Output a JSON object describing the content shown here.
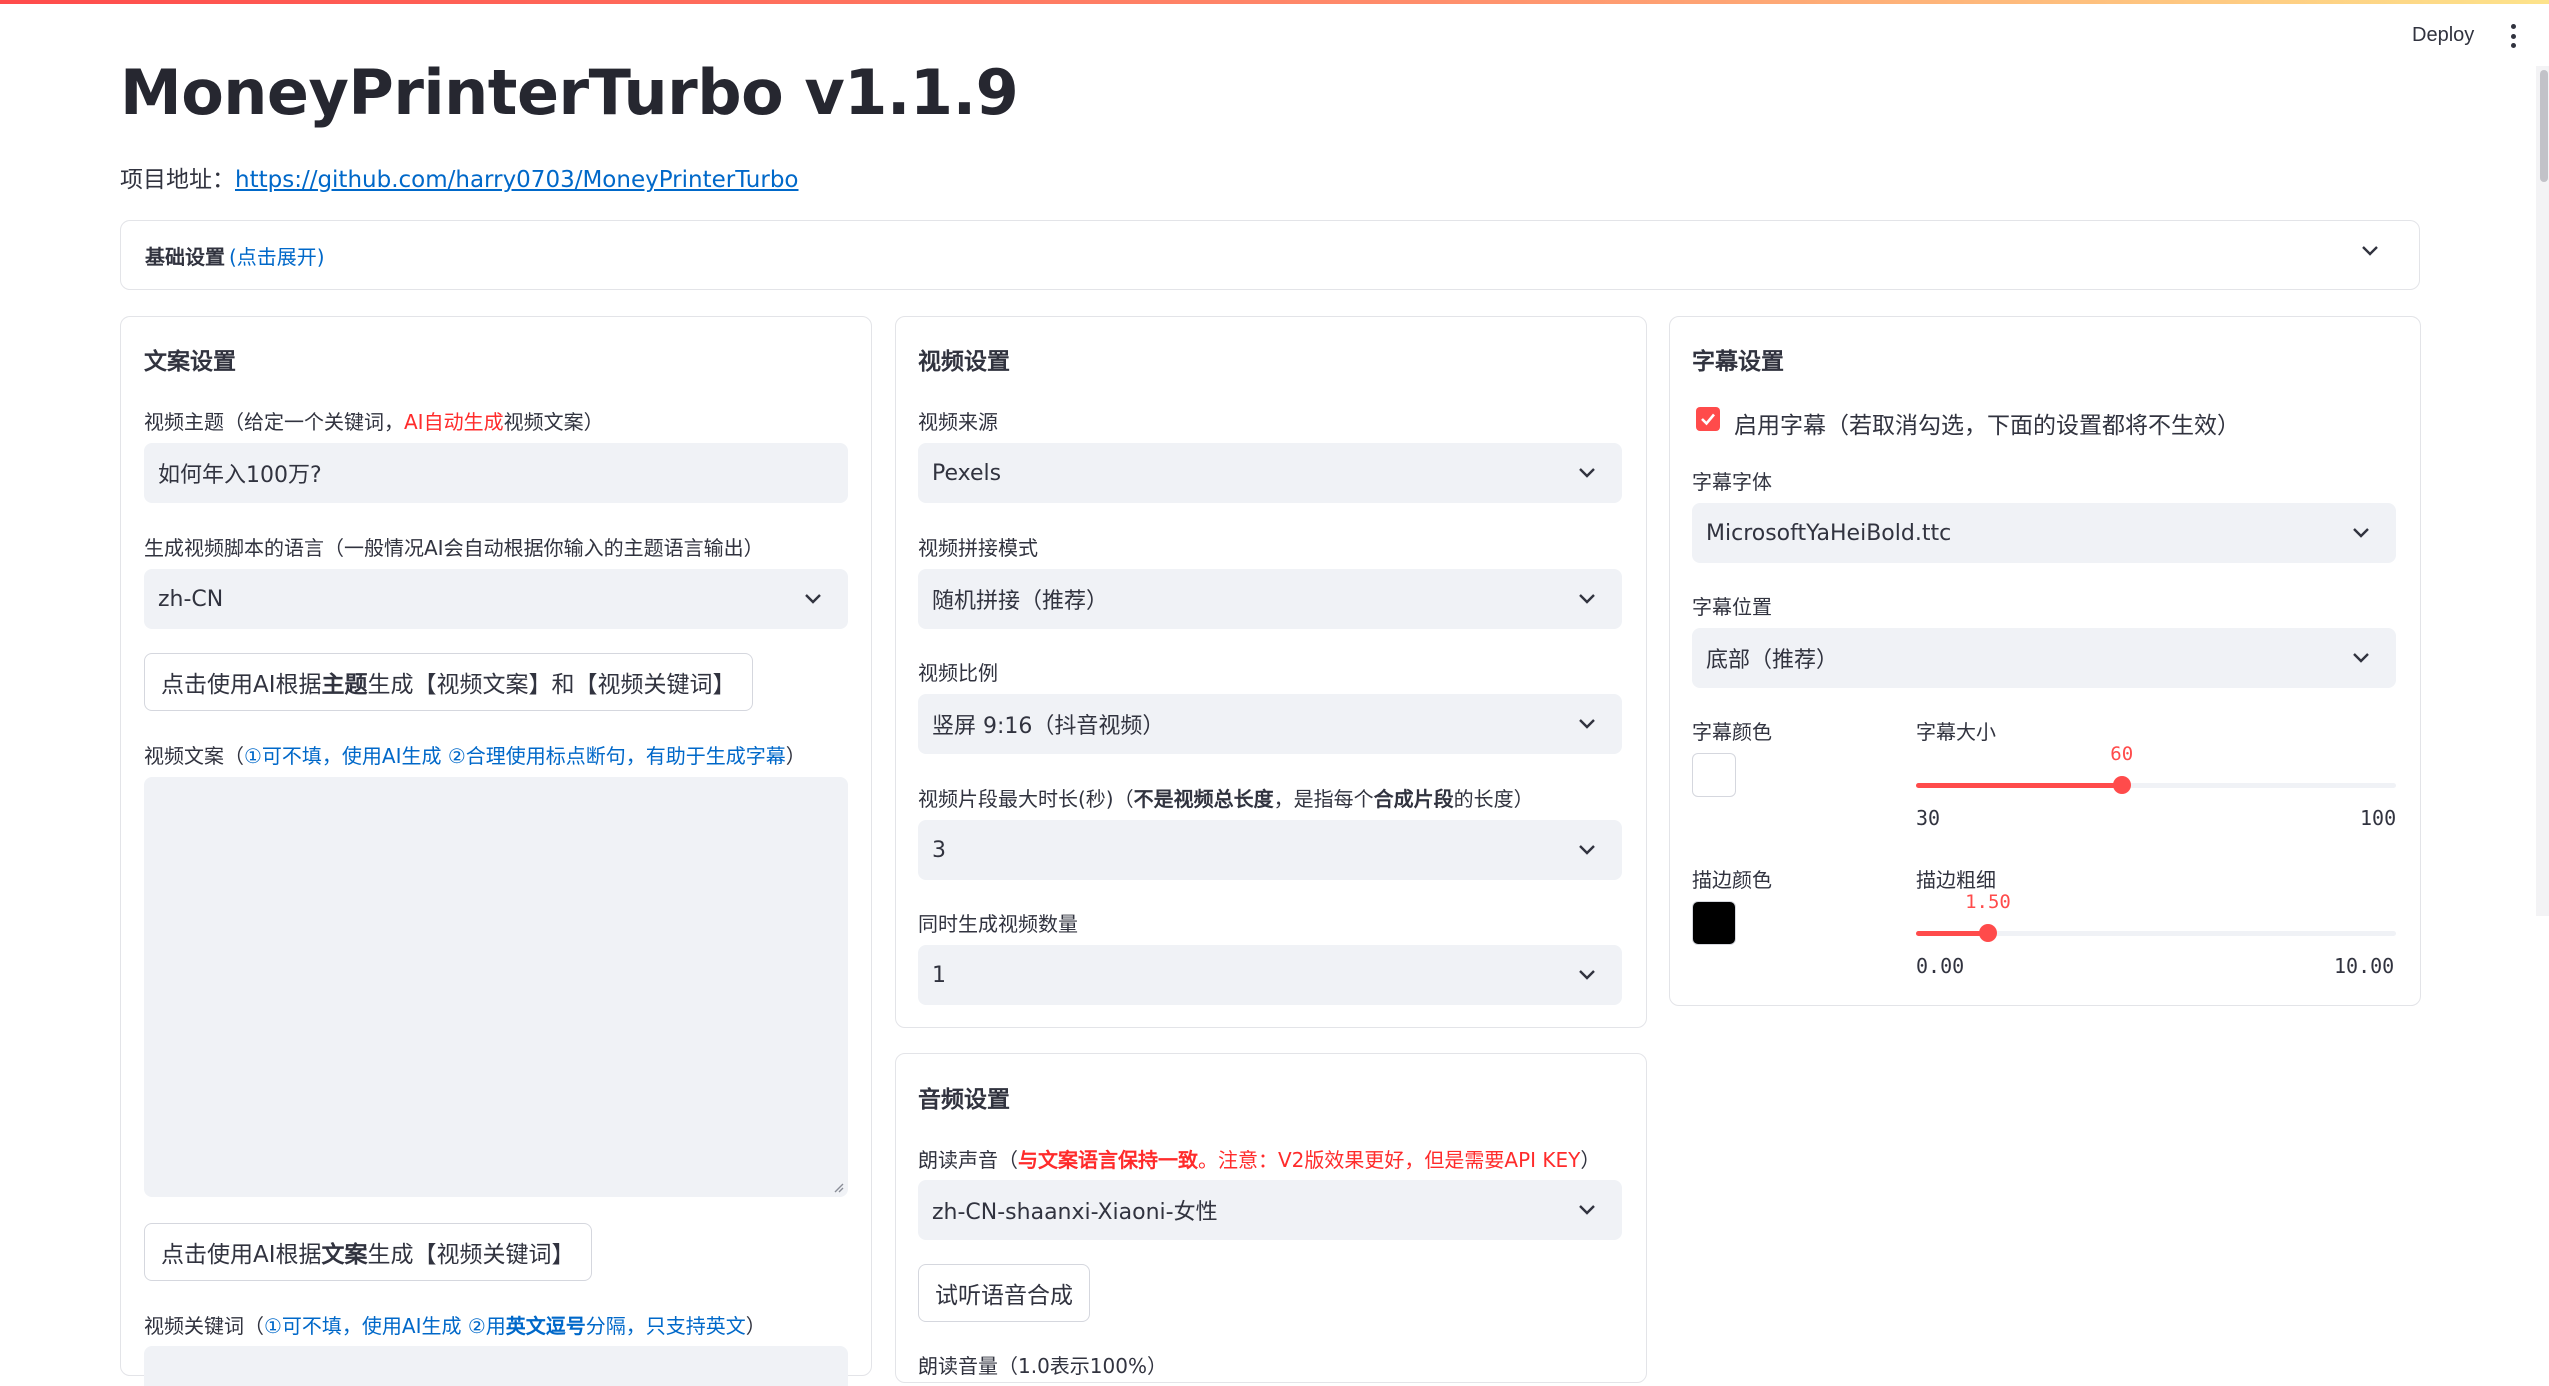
{
  "header": {
    "deploy_label": "Deploy",
    "menu_icon": "kebab-menu-icon"
  },
  "page": {
    "title": "MoneyPrinterTurbo v1.1.9",
    "repo_prefix": "项目地址：",
    "repo_url": "https://github.com/harry0703/MoneyPrinterTurbo"
  },
  "basic_settings": {
    "label": "基础设置",
    "hint": "(点击展开)"
  },
  "copy_settings": {
    "title": "文案设置",
    "topic_label_a": "视频主题（给定一个关键词，",
    "topic_label_red": "AI自动生成",
    "topic_label_b": "视频文案）",
    "topic_value": "如何年入100万?",
    "lang_label": "生成视频脚本的语言（一般情况AI会自动根据你输入的主题语言输出）",
    "lang_value": "zh-CN",
    "gen_btn_a": "点击使用AI根据",
    "gen_btn_b": "主题",
    "gen_btn_c": "生成【视频文案】和【视频关键词】",
    "script_label_a": "视频文案（",
    "script_label_blue": "①可不填，使用AI生成 ②合理使用标点断句，有助于生成字幕",
    "script_label_b": "）",
    "script_value": "",
    "kw_btn_a": "点击使用AI根据",
    "kw_btn_b": "文案",
    "kw_btn_c": "生成【视频关键词】",
    "kw_label_a": "视频关键词（",
    "kw_label_blue1": "①可不填，使用AI生成 ②用",
    "kw_label_bold": "英文逗号",
    "kw_label_blue2": "分隔，只支持英文",
    "kw_label_b": "）"
  },
  "video_settings": {
    "title": "视频设置",
    "source_label": "视频来源",
    "source_value": "Pexels",
    "concat_label": "视频拼接模式",
    "concat_value": "随机拼接（推荐）",
    "ratio_label": "视频比例",
    "ratio_value": "竖屏 9:16（抖音视频）",
    "clip_label_a": "视频片段最大时长(秒)（",
    "clip_label_bold1": "不是视频总长度",
    "clip_label_b": "，是指每个",
    "clip_label_bold2": "合成片段",
    "clip_label_c": "的长度）",
    "clip_value": "3",
    "count_label": "同时生成视频数量",
    "count_value": "1"
  },
  "audio_settings": {
    "title": "音频设置",
    "voice_label_a": "朗读声音（",
    "voice_label_red1": "与文案语言保持一致",
    "voice_label_red2": "。注意：V2版效果更好，但是需要API KEY",
    "voice_label_b": "）",
    "voice_value": "zh-CN-shaanxi-Xiaoni-女性",
    "test_btn": "试听语音合成",
    "volume_label": "朗读音量（1.0表示100%）"
  },
  "subtitle_settings": {
    "title": "字幕设置",
    "enable_label": "启用字幕（若取消勾选，下面的设置都将不生效）",
    "enable_checked": true,
    "font_label": "字幕字体",
    "font_value": "MicrosoftYaHeiBold.ttc",
    "position_label": "字幕位置",
    "position_value": "底部（推荐）",
    "color_label": "字幕颜色",
    "color_value": "#ffffff",
    "size_label": "字幕大小",
    "size_value": "60",
    "size_min": "30",
    "size_max": "100",
    "size_fraction": 0.4286,
    "stroke_color_label": "描边颜色",
    "stroke_color_value": "#000000",
    "stroke_width_label": "描边粗细",
    "stroke_width_value": "1.50",
    "stroke_width_min": "0.00",
    "stroke_width_max": "10.00",
    "stroke_width_fraction": 0.15
  },
  "colors": {
    "accent": "#ff4b4b",
    "link": "#0068c9",
    "input_bg": "#f0f2f6"
  }
}
